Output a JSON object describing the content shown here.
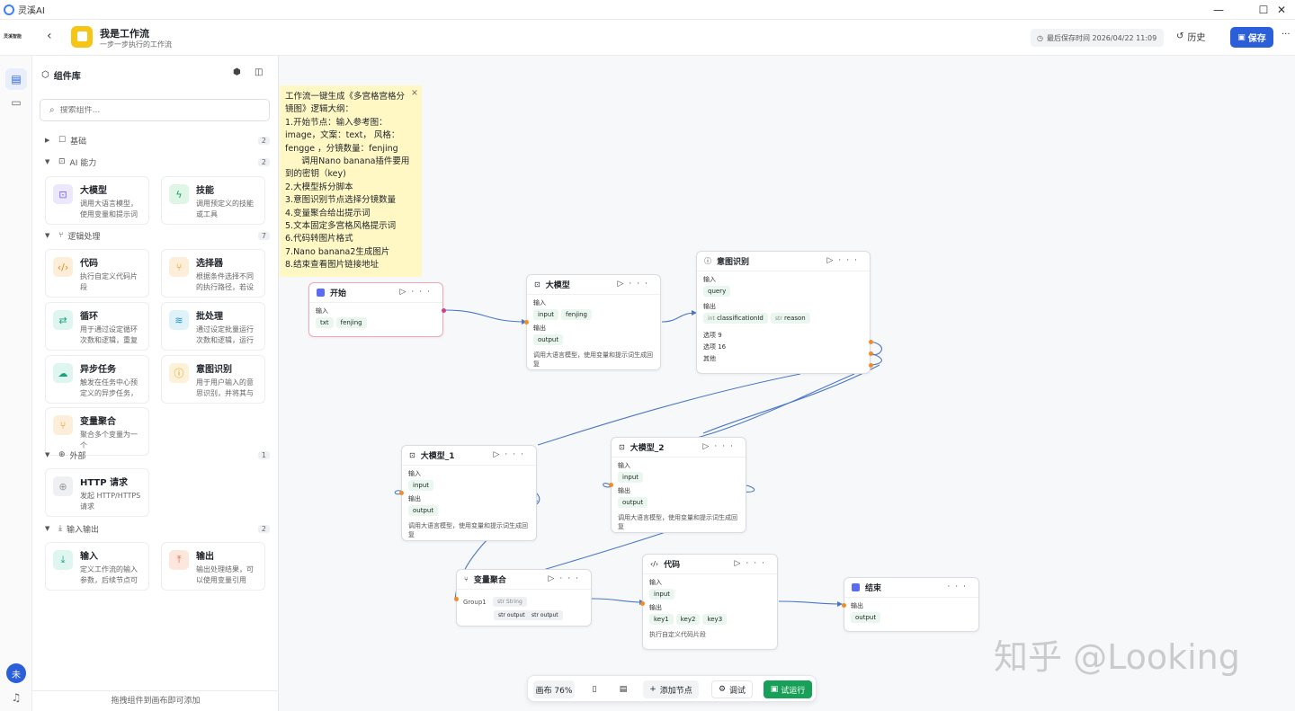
{
  "window": {
    "app_name": "灵溪AI",
    "minimize": "—",
    "maximize": "☐",
    "close": "✕"
  },
  "header": {
    "brand": "灵溪智能",
    "title": "我是工作流",
    "subtitle": "一步一步执行的工作流",
    "last_saved": "最后保存时间 2026/04/22 11:09",
    "history_label": "历史",
    "save_label": "保存",
    "more": "···"
  },
  "rail": {
    "avatar_text": "未"
  },
  "library": {
    "title": "组件库",
    "search_placeholder": "搜索组件...",
    "footer_hint": "拖拽组件到画布即可添加",
    "sections": {
      "basic": {
        "name": "基础",
        "count": "2"
      },
      "ai": {
        "name": "AI 能力",
        "count": "2"
      },
      "logic": {
        "name": "逻辑处理",
        "count": "7"
      },
      "external": {
        "name": "外部",
        "count": "1"
      },
      "io": {
        "name": "输入输出",
        "count": "2"
      }
    },
    "cards": {
      "llm": {
        "title": "大模型",
        "desc": "调用大语言模型，使用变量和提示词生成..."
      },
      "skill": {
        "title": "技能",
        "desc": "调用预定义的技能或工具"
      },
      "code": {
        "title": "代码",
        "desc": "执行自定义代码片段"
      },
      "selector": {
        "title": "选择器",
        "desc": "根据条件选择不同的执行路径，若设定的..."
      },
      "loop": {
        "title": "循环",
        "desc": "用于通过设定循环次数和逻辑，重复执行..."
      },
      "batch": {
        "title": "批处理",
        "desc": "通过设定批量运行次数和逻辑，运行批处..."
      },
      "async": {
        "title": "异步任务",
        "desc": "触发在任务中心预定义的异步任务，创建..."
      },
      "intent": {
        "title": "意图识别",
        "desc": "用于用户输入的意思识别，并将其与预设..."
      },
      "aggregate": {
        "title": "变量聚合",
        "desc": "聚合多个变量为一个"
      },
      "http": {
        "title": "HTTP 请求",
        "desc": "发起 HTTP/HTTPS 请求"
      },
      "input": {
        "title": "输入",
        "desc": "定义工作流的输入参数，后续节点可以引..."
      },
      "output": {
        "title": "输出",
        "desc": "输出处理结果，可以使用变量引用"
      }
    }
  },
  "note": {
    "lines": [
      "工作流一键生成《多宫格宫格分",
      "镜图》逻辑大纲：",
      "1.开始节点：输入参考图：",
      "image，文案：text， 风格：",
      "fengge ，分镜数量：fenjing",
      "      调用Nano banana插件要用",
      "到的密钥（key)",
      "2.大模型拆分脚本",
      "3.意图识别节点选择分镜数量",
      "4.变量聚合给出提示词",
      "5.文本固定多宫格风格提示词",
      "6.代码转图片格式",
      "7.Nano banana2生成图片",
      "8.结束查看图片链接地址"
    ],
    "close": "×"
  },
  "nodes": {
    "start": {
      "title": "开始",
      "input_label": "输入",
      "tags": [
        "txt",
        "fenjing"
      ]
    },
    "llm": {
      "title": "大模型",
      "input_label": "输入",
      "inputs": [
        "input",
        "fenjing"
      ],
      "output_label": "输出",
      "outputs": [
        "output"
      ],
      "desc": "调用大语言模型，使用变量和提示词生成回复"
    },
    "intent": {
      "title": "意图识别",
      "input_label": "输入",
      "inputs": [
        "query"
      ],
      "output_label": "输出",
      "out1_type": "int",
      "out1": "classificationId",
      "out2_type": "str",
      "out2": "reason",
      "options": [
        "选项 9",
        "选项 16",
        "其他"
      ]
    },
    "llm1": {
      "title": "大模型_1",
      "input_label": "输入",
      "inputs": [
        "input"
      ],
      "output_label": "输出",
      "outputs": [
        "output"
      ],
      "desc": "调用大语言模型，使用变量和提示词生成回复"
    },
    "llm2": {
      "title": "大模型_2",
      "input_label": "输入",
      "inputs": [
        "input"
      ],
      "output_label": "输出",
      "outputs": [
        "output"
      ],
      "desc": "调用大语言模型，使用变量和提示词生成回复"
    },
    "agg": {
      "title": "变量聚合",
      "group": "Group1",
      "type_tag": "str String",
      "vars": [
        "str output",
        "str output"
      ]
    },
    "code": {
      "title": "代码",
      "input_label": "输入",
      "inputs": [
        "input"
      ],
      "output_label": "输出",
      "outputs": [
        "key1",
        "key2",
        "key3"
      ],
      "desc": "执行自定义代码片段"
    },
    "end": {
      "title": "结束",
      "output_label": "输出",
      "outputs": [
        "output"
      ]
    }
  },
  "watermark": "知乎 @Looking",
  "toolbar": {
    "zoom": "画布 76%",
    "add_node": "添加节点",
    "debug": "调试",
    "run": "试运行"
  },
  "colors": {
    "accent": "#2b5fd9",
    "run_green": "#18a058",
    "note_bg": "#fff8c4",
    "port": "#f08c2a",
    "edge": "#4a78c6"
  }
}
